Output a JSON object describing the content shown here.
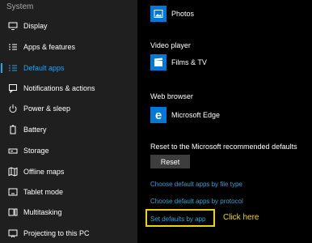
{
  "sidebar": {
    "section_title": "System",
    "items": [
      {
        "label": "Display",
        "icon": "display-icon",
        "active": false
      },
      {
        "label": "Apps & features",
        "icon": "apps-list-icon",
        "active": false
      },
      {
        "label": "Default apps",
        "icon": "default-apps-icon",
        "active": true
      },
      {
        "label": "Notifications & actions",
        "icon": "notifications-icon",
        "active": false
      },
      {
        "label": "Power & sleep",
        "icon": "power-icon",
        "active": false
      },
      {
        "label": "Battery",
        "icon": "battery-icon",
        "active": false
      },
      {
        "label": "Storage",
        "icon": "storage-icon",
        "active": false
      },
      {
        "label": "Offline maps",
        "icon": "map-icon",
        "active": false
      },
      {
        "label": "Tablet mode",
        "icon": "tablet-icon",
        "active": false
      },
      {
        "label": "Multitasking",
        "icon": "multitasking-icon",
        "active": false
      },
      {
        "label": "Projecting to this PC",
        "icon": "projecting-icon",
        "active": false
      }
    ]
  },
  "main": {
    "photos": {
      "app_name": "Photos",
      "icon": "photos-icon"
    },
    "video_player": {
      "heading": "Video player",
      "app_name": "Films & TV",
      "icon": "films-tv-icon"
    },
    "web_browser": {
      "heading": "Web browser",
      "app_name": "Microsoft Edge",
      "icon": "edge-icon"
    },
    "reset": {
      "heading": "Reset to the Microsoft recommended defaults",
      "button_label": "Reset"
    },
    "links": {
      "by_file_type": "Choose default apps by file type",
      "by_protocol": "Choose default apps by protocol",
      "by_app": "Set defaults by app"
    },
    "callout": "Click here"
  },
  "colors": {
    "accent": "#2aa4e6",
    "link": "#2ea3d6",
    "tile": "#0078d7",
    "highlight": "#f2d400",
    "sidebar_bg": "#1f1f1f",
    "main_bg": "#000000"
  }
}
